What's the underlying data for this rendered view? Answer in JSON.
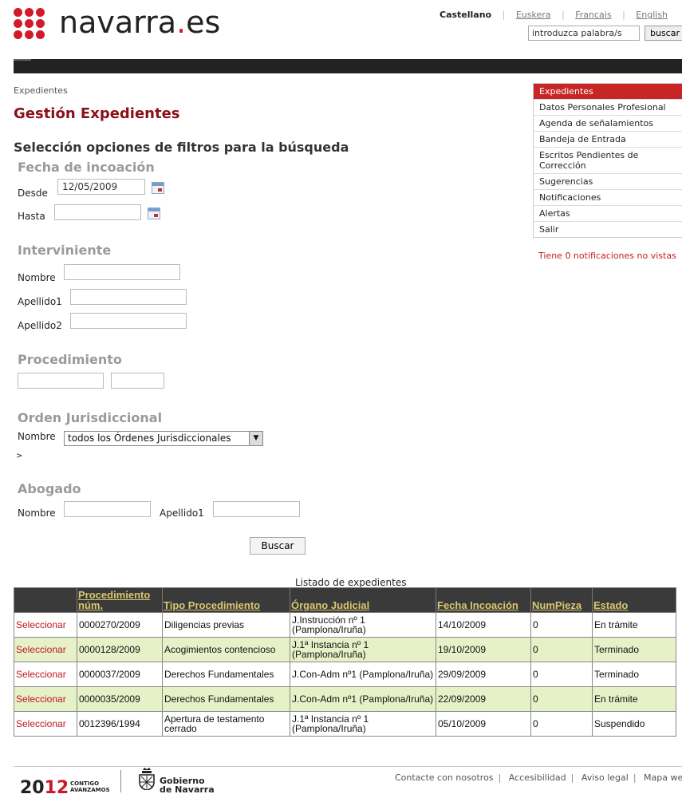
{
  "header": {
    "logo_prefix": "navarra",
    "logo_dot": ".",
    "logo_suffix": "es",
    "languages": {
      "selected": "Castellano",
      "others": [
        "Euskera",
        "Francais",
        "English"
      ]
    },
    "search_placeholder": "introduzca palabra/s",
    "search_button": "buscar"
  },
  "breadcrumb": "Expedientes",
  "page_title": "Gestión Expedientes",
  "filters_heading": "Selección opciones de filtros para la búsqueda",
  "fecha": {
    "title": "Fecha de incoación",
    "desde_label": "Desde",
    "desde_value": "12/05/2009",
    "hasta_label": "Hasta",
    "hasta_value": ""
  },
  "interviniente": {
    "title": "Interviniente",
    "nombre_label": "Nombre",
    "apellido1_label": "Apellido1",
    "apellido2_label": "Apellido2"
  },
  "procedimiento": {
    "title": "Procedimiento"
  },
  "orden": {
    "title": "Orden Jurisdiccional",
    "nombre_label": "Nombre",
    "selected": "todos los Órdenes Jurisdiccionales",
    "arrow": ">"
  },
  "abogado": {
    "title": "Abogado",
    "nombre_label": "Nombre",
    "apellido1_label": "Apellido1"
  },
  "buscar_button": "Buscar",
  "menu": {
    "items": [
      "Expedientes",
      "Datos Personales Profesional",
      "Agenda de señalamientos",
      "Bandeja de Entrada",
      "Escritos Pendientes de Corrección",
      "Sugerencias",
      "Notificaciones",
      "Alertas",
      "Salir"
    ],
    "active_index": 0,
    "notifications_text": "Tiene 0 notificaciones no vistas"
  },
  "table": {
    "caption": "Listado de expedientes",
    "headers": [
      "",
      "Procedimiento núm.",
      "Tipo Procedimiento",
      "Órgano Judicial",
      "Fecha Incoación",
      "NumPieza",
      "Estado"
    ],
    "rows": [
      {
        "action": "Seleccionar",
        "num": "0000270/2009",
        "tipo": "Diligencias previas",
        "organo": "J.Instrucción nº 1 (Pamplona/Iruña)",
        "fecha": "14/10/2009",
        "pieza": "0",
        "estado": "En trámite"
      },
      {
        "action": "Seleccionar",
        "num": "0000128/2009",
        "tipo": "Acogimientos contencioso",
        "organo": "J.1ª Instancia nº 1 (Pamplona/Iruña)",
        "fecha": "19/10/2009",
        "pieza": "0",
        "estado": "Terminado"
      },
      {
        "action": "Seleccionar",
        "num": "0000037/2009",
        "tipo": "Derechos Fundamentales",
        "organo": "J.Con-Adm nº1 (Pamplona/Iruña)",
        "fecha": "29/09/2009",
        "pieza": "0",
        "estado": "Terminado"
      },
      {
        "action": "Seleccionar",
        "num": "0000035/2009",
        "tipo": "Derechos Fundamentales",
        "organo": "J.Con-Adm nº1 (Pamplona/Iruña)",
        "fecha": "22/09/2009",
        "pieza": "0",
        "estado": "En trámite"
      },
      {
        "action": "Seleccionar",
        "num": "0012396/1994",
        "tipo": "Apertura de testamento cerrado",
        "organo": "J.1ª Instancia nº 1 (Pamplona/Iruña)",
        "fecha": "05/10/2009",
        "pieza": "0",
        "estado": "Suspendido"
      }
    ]
  },
  "footer": {
    "year_prefix": "20",
    "year_suffix": "12",
    "slogan_1": "CONTIGO",
    "slogan_2": "AVANZAMOS",
    "gov_line1": "Gobierno",
    "gov_line2": "de Navarra",
    "links": [
      "Contacte con nosotros",
      "Accesibilidad",
      "Aviso legal",
      "Mapa web"
    ]
  },
  "colors": {
    "brand_red": "#d21a2b",
    "title_red": "#8b1018",
    "table_header_bg": "#3a3a3a",
    "row_alt": "#e6f1c8"
  }
}
